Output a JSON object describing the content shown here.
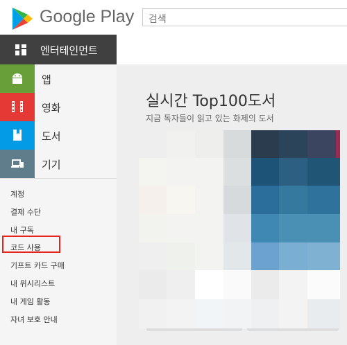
{
  "header": {
    "logo_text": "Google Play",
    "search_placeholder": "검색"
  },
  "category": {
    "label": "엔터테인먼트"
  },
  "nav": [
    {
      "label": "앱",
      "icon": "android-icon",
      "color": "#689f38"
    },
    {
      "label": "영화",
      "icon": "film-icon",
      "color": "#e53935"
    },
    {
      "label": "도서",
      "icon": "book-icon",
      "color": "#039be5"
    },
    {
      "label": "기기",
      "icon": "devices-icon",
      "color": "#607d8b"
    }
  ],
  "account_links": [
    "계정",
    "결제 수단",
    "내 구독",
    "코드 사용",
    "기프트 카드 구매",
    "내 위시리스트",
    "내 게임 활동",
    "자녀 보호 안내"
  ],
  "main": {
    "title": "실시간 Top100도서",
    "subtitle": "지금 독자들이 읽고 있는 화제의 도서"
  }
}
